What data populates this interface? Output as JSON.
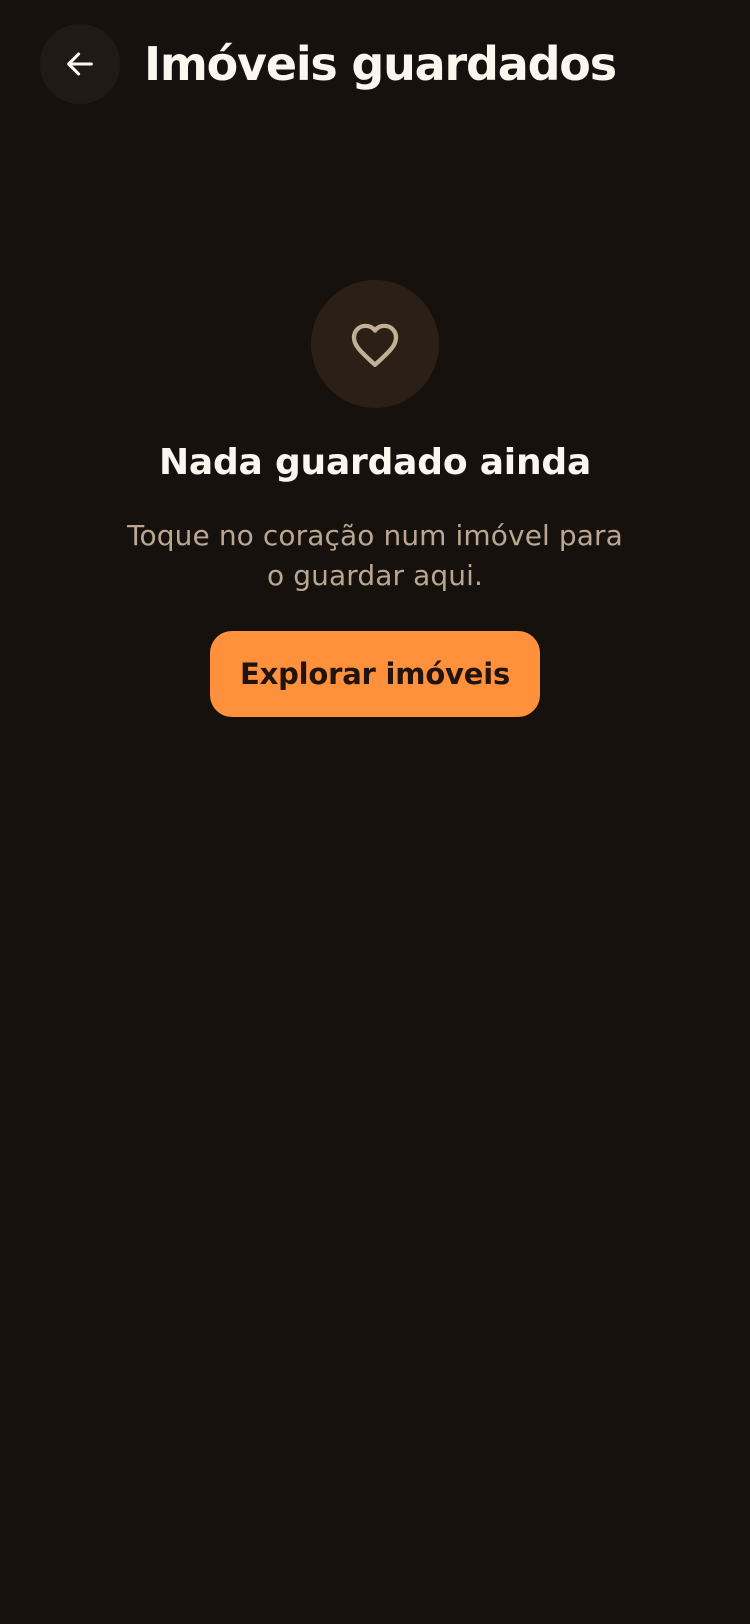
{
  "header": {
    "title": "Imóveis guardados",
    "back_icon": "arrow-left-icon"
  },
  "empty_state": {
    "icon": "heart-icon",
    "title": "Nada guardado ainda",
    "description": "Toque no coração num imóvel para o guardar aqui.",
    "button_label": "Explorar imóveis"
  },
  "colors": {
    "background": "#17110d",
    "back_button": "#211914",
    "heart_circle": "#2c2016",
    "heart_outline": "#c3ae97",
    "description": "#b9a792",
    "accent": "#ff913d",
    "button_text": "#20140c"
  }
}
